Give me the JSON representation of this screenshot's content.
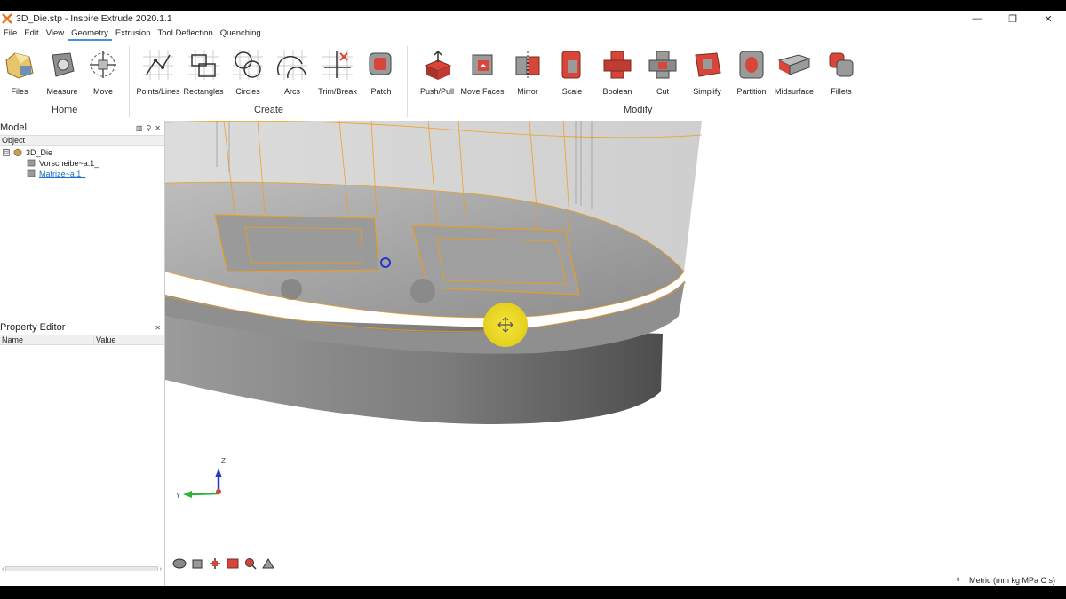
{
  "window": {
    "title": "3D_Die.stp - Inspire Extrude 2020.1.1",
    "minimize": "—",
    "maximize": "❐",
    "close": "✕"
  },
  "menu": [
    "File",
    "Edit",
    "View",
    "Geometry",
    "Extrusion",
    "Tool Deflection",
    "Quenching"
  ],
  "menu_active": "Geometry",
  "ribbon": {
    "groups": [
      "Home",
      "Create",
      "Modify"
    ],
    "home": [
      "Files",
      "Measure",
      "Move"
    ],
    "create": [
      "Points/Lines",
      "Rectangles",
      "Circles",
      "Arcs",
      "Trim/Break",
      "Patch"
    ],
    "modify": [
      "Push/Pull",
      "Move Faces",
      "Mirror",
      "Scale",
      "Boolean",
      "Cut",
      "Simplify",
      "Partition",
      "Midsurface",
      "Fillets"
    ]
  },
  "model_panel": {
    "title": "Model",
    "column": "Object",
    "tree": {
      "root": "3D_Die",
      "root_toggle": "⊟",
      "children": [
        "Vorscheibe~a.1_",
        "Matrize~a.1_"
      ]
    }
  },
  "property_panel": {
    "title": "Property Editor",
    "columns": [
      "Name",
      "Value"
    ]
  },
  "axis": {
    "z": "Z",
    "y": "Y"
  },
  "status": {
    "units": "Metric (mm kg MPa C s)"
  },
  "colors": {
    "accent": "#4a90d9",
    "highlight_edge": "#f39c12",
    "cursor_highlight": "#f2e12a",
    "icon_red": "#d8463a"
  }
}
